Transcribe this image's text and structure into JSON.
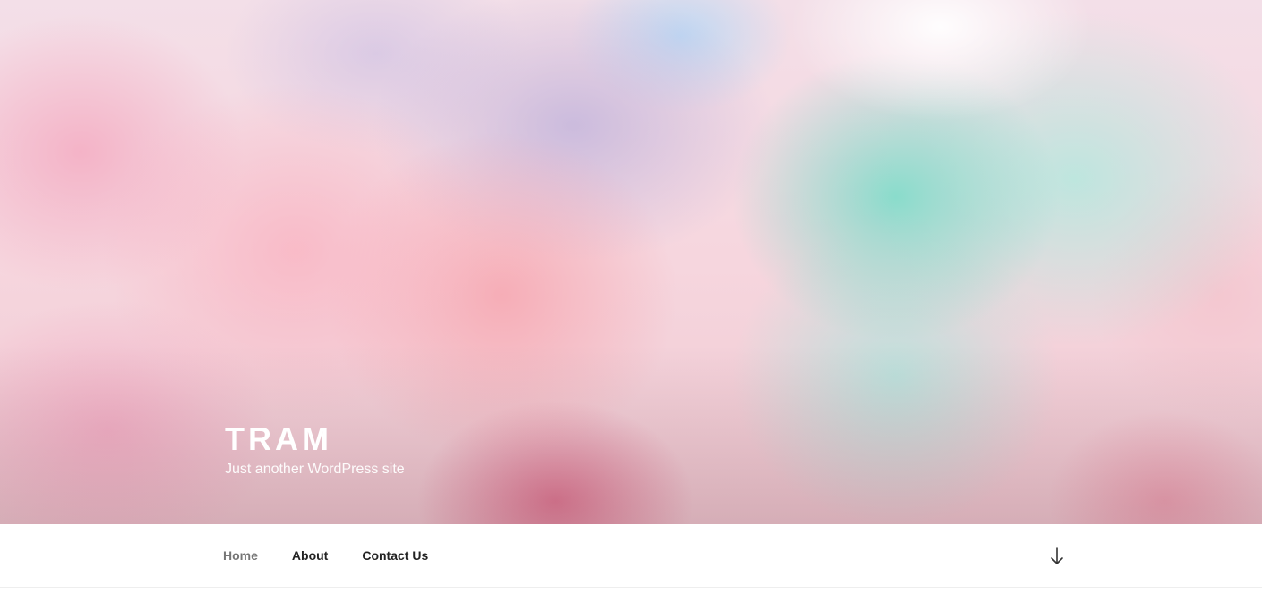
{
  "site": {
    "title": "TRAM",
    "description": "Just another WordPress site"
  },
  "nav": {
    "items": [
      {
        "label": "Home",
        "current": true
      },
      {
        "label": "About",
        "current": false
      },
      {
        "label": "Contact Us",
        "current": false
      }
    ],
    "scroll_icon": "arrow-down-icon"
  },
  "colors": {
    "title": "#ffffff",
    "nav_text": "#222222",
    "nav_current": "#767676",
    "nav_border": "#eeeeee"
  }
}
